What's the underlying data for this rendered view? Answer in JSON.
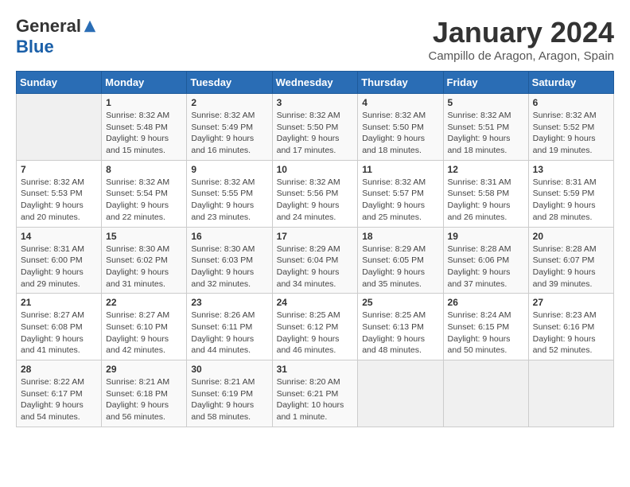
{
  "header": {
    "logo_general": "General",
    "logo_blue": "Blue",
    "month_title": "January 2024",
    "location": "Campillo de Aragon, Aragon, Spain"
  },
  "days_of_week": [
    "Sunday",
    "Monday",
    "Tuesday",
    "Wednesday",
    "Thursday",
    "Friday",
    "Saturday"
  ],
  "weeks": [
    [
      {
        "day": "",
        "sunrise": "",
        "sunset": "",
        "daylight": ""
      },
      {
        "day": "1",
        "sunrise": "Sunrise: 8:32 AM",
        "sunset": "Sunset: 5:48 PM",
        "daylight": "Daylight: 9 hours and 15 minutes."
      },
      {
        "day": "2",
        "sunrise": "Sunrise: 8:32 AM",
        "sunset": "Sunset: 5:49 PM",
        "daylight": "Daylight: 9 hours and 16 minutes."
      },
      {
        "day": "3",
        "sunrise": "Sunrise: 8:32 AM",
        "sunset": "Sunset: 5:50 PM",
        "daylight": "Daylight: 9 hours and 17 minutes."
      },
      {
        "day": "4",
        "sunrise": "Sunrise: 8:32 AM",
        "sunset": "Sunset: 5:50 PM",
        "daylight": "Daylight: 9 hours and 18 minutes."
      },
      {
        "day": "5",
        "sunrise": "Sunrise: 8:32 AM",
        "sunset": "Sunset: 5:51 PM",
        "daylight": "Daylight: 9 hours and 18 minutes."
      },
      {
        "day": "6",
        "sunrise": "Sunrise: 8:32 AM",
        "sunset": "Sunset: 5:52 PM",
        "daylight": "Daylight: 9 hours and 19 minutes."
      }
    ],
    [
      {
        "day": "7",
        "sunrise": "Sunrise: 8:32 AM",
        "sunset": "Sunset: 5:53 PM",
        "daylight": "Daylight: 9 hours and 20 minutes."
      },
      {
        "day": "8",
        "sunrise": "Sunrise: 8:32 AM",
        "sunset": "Sunset: 5:54 PM",
        "daylight": "Daylight: 9 hours and 22 minutes."
      },
      {
        "day": "9",
        "sunrise": "Sunrise: 8:32 AM",
        "sunset": "Sunset: 5:55 PM",
        "daylight": "Daylight: 9 hours and 23 minutes."
      },
      {
        "day": "10",
        "sunrise": "Sunrise: 8:32 AM",
        "sunset": "Sunset: 5:56 PM",
        "daylight": "Daylight: 9 hours and 24 minutes."
      },
      {
        "day": "11",
        "sunrise": "Sunrise: 8:32 AM",
        "sunset": "Sunset: 5:57 PM",
        "daylight": "Daylight: 9 hours and 25 minutes."
      },
      {
        "day": "12",
        "sunrise": "Sunrise: 8:31 AM",
        "sunset": "Sunset: 5:58 PM",
        "daylight": "Daylight: 9 hours and 26 minutes."
      },
      {
        "day": "13",
        "sunrise": "Sunrise: 8:31 AM",
        "sunset": "Sunset: 5:59 PM",
        "daylight": "Daylight: 9 hours and 28 minutes."
      }
    ],
    [
      {
        "day": "14",
        "sunrise": "Sunrise: 8:31 AM",
        "sunset": "Sunset: 6:00 PM",
        "daylight": "Daylight: 9 hours and 29 minutes."
      },
      {
        "day": "15",
        "sunrise": "Sunrise: 8:30 AM",
        "sunset": "Sunset: 6:02 PM",
        "daylight": "Daylight: 9 hours and 31 minutes."
      },
      {
        "day": "16",
        "sunrise": "Sunrise: 8:30 AM",
        "sunset": "Sunset: 6:03 PM",
        "daylight": "Daylight: 9 hours and 32 minutes."
      },
      {
        "day": "17",
        "sunrise": "Sunrise: 8:29 AM",
        "sunset": "Sunset: 6:04 PM",
        "daylight": "Daylight: 9 hours and 34 minutes."
      },
      {
        "day": "18",
        "sunrise": "Sunrise: 8:29 AM",
        "sunset": "Sunset: 6:05 PM",
        "daylight": "Daylight: 9 hours and 35 minutes."
      },
      {
        "day": "19",
        "sunrise": "Sunrise: 8:28 AM",
        "sunset": "Sunset: 6:06 PM",
        "daylight": "Daylight: 9 hours and 37 minutes."
      },
      {
        "day": "20",
        "sunrise": "Sunrise: 8:28 AM",
        "sunset": "Sunset: 6:07 PM",
        "daylight": "Daylight: 9 hours and 39 minutes."
      }
    ],
    [
      {
        "day": "21",
        "sunrise": "Sunrise: 8:27 AM",
        "sunset": "Sunset: 6:08 PM",
        "daylight": "Daylight: 9 hours and 41 minutes."
      },
      {
        "day": "22",
        "sunrise": "Sunrise: 8:27 AM",
        "sunset": "Sunset: 6:10 PM",
        "daylight": "Daylight: 9 hours and 42 minutes."
      },
      {
        "day": "23",
        "sunrise": "Sunrise: 8:26 AM",
        "sunset": "Sunset: 6:11 PM",
        "daylight": "Daylight: 9 hours and 44 minutes."
      },
      {
        "day": "24",
        "sunrise": "Sunrise: 8:25 AM",
        "sunset": "Sunset: 6:12 PM",
        "daylight": "Daylight: 9 hours and 46 minutes."
      },
      {
        "day": "25",
        "sunrise": "Sunrise: 8:25 AM",
        "sunset": "Sunset: 6:13 PM",
        "daylight": "Daylight: 9 hours and 48 minutes."
      },
      {
        "day": "26",
        "sunrise": "Sunrise: 8:24 AM",
        "sunset": "Sunset: 6:15 PM",
        "daylight": "Daylight: 9 hours and 50 minutes."
      },
      {
        "day": "27",
        "sunrise": "Sunrise: 8:23 AM",
        "sunset": "Sunset: 6:16 PM",
        "daylight": "Daylight: 9 hours and 52 minutes."
      }
    ],
    [
      {
        "day": "28",
        "sunrise": "Sunrise: 8:22 AM",
        "sunset": "Sunset: 6:17 PM",
        "daylight": "Daylight: 9 hours and 54 minutes."
      },
      {
        "day": "29",
        "sunrise": "Sunrise: 8:21 AM",
        "sunset": "Sunset: 6:18 PM",
        "daylight": "Daylight: 9 hours and 56 minutes."
      },
      {
        "day": "30",
        "sunrise": "Sunrise: 8:21 AM",
        "sunset": "Sunset: 6:19 PM",
        "daylight": "Daylight: 9 hours and 58 minutes."
      },
      {
        "day": "31",
        "sunrise": "Sunrise: 8:20 AM",
        "sunset": "Sunset: 6:21 PM",
        "daylight": "Daylight: 10 hours and 1 minute."
      },
      {
        "day": "",
        "sunrise": "",
        "sunset": "",
        "daylight": ""
      },
      {
        "day": "",
        "sunrise": "",
        "sunset": "",
        "daylight": ""
      },
      {
        "day": "",
        "sunrise": "",
        "sunset": "",
        "daylight": ""
      }
    ]
  ]
}
